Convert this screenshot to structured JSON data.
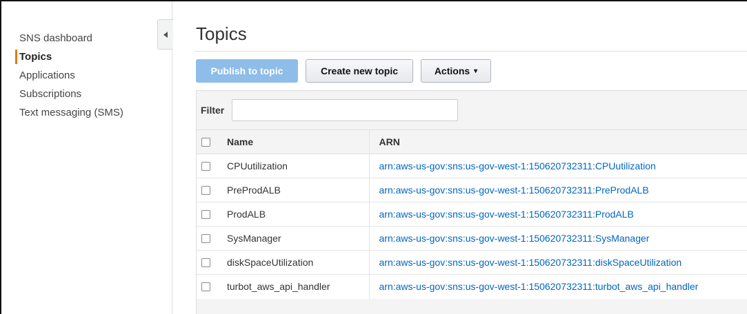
{
  "sidebar": {
    "items": [
      {
        "label": "SNS dashboard",
        "active": false
      },
      {
        "label": "Topics",
        "active": true
      },
      {
        "label": "Applications",
        "active": false
      },
      {
        "label": "Subscriptions",
        "active": false
      },
      {
        "label": "Text messaging (SMS)",
        "active": false
      }
    ],
    "collapse_icon": "triangle-left-icon"
  },
  "main": {
    "title": "Topics",
    "toolbar": {
      "publish_label": "Publish to topic",
      "create_label": "Create new topic",
      "actions_label": "Actions",
      "actions_caret": "▾"
    },
    "filter": {
      "label": "Filter",
      "value": "",
      "placeholder": ""
    },
    "table": {
      "headers": {
        "name": "Name",
        "arn": "ARN"
      },
      "rows": [
        {
          "name": "CPUutilization",
          "arn": "arn:aws-us-gov:sns:us-gov-west-1:150620732311:CPUutilization"
        },
        {
          "name": "PreProdALB",
          "arn": "arn:aws-us-gov:sns:us-gov-west-1:150620732311:PreProdALB"
        },
        {
          "name": "ProdALB",
          "arn": "arn:aws-us-gov:sns:us-gov-west-1:150620732311:ProdALB"
        },
        {
          "name": "SysManager",
          "arn": "arn:aws-us-gov:sns:us-gov-west-1:150620732311:SysManager"
        },
        {
          "name": "diskSpaceUtilization",
          "arn": "arn:aws-us-gov:sns:us-gov-west-1:150620732311:diskSpaceUtilization"
        },
        {
          "name": "turbot_aws_api_handler",
          "arn": "arn:aws-us-gov:sns:us-gov-west-1:150620732311:turbot_aws_api_handler"
        }
      ]
    }
  },
  "colors": {
    "accent_orange": "#e47911",
    "primary_button": "#8dbde8",
    "link": "#0066c0"
  }
}
